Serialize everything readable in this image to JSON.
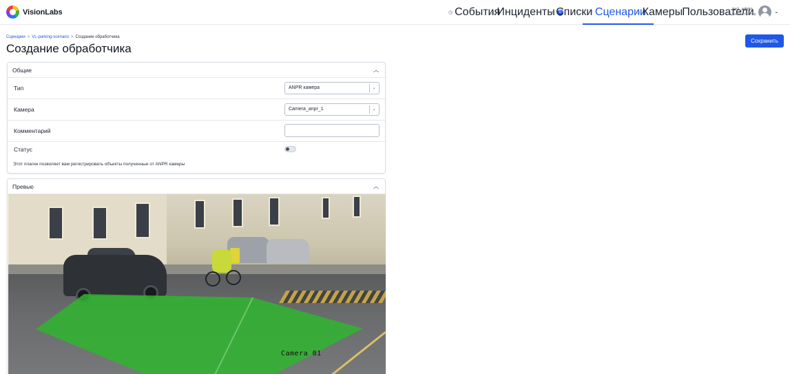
{
  "app": {
    "brand": "VisionLabs"
  },
  "nav": {
    "events": "События",
    "incidents": "Инциденты",
    "incidents_count": "0",
    "lists": "Списки",
    "scenarios": "Сценарии",
    "cameras": "Камеры",
    "users": "Пользователи"
  },
  "user": {
    "name": "test_admin",
    "role": "Администратор"
  },
  "breadcrumb": {
    "items": [
      "Сценарии",
      "VL-parking-scenario",
      "Создание обработчика"
    ],
    "separator": ">"
  },
  "page": {
    "title": "Создание обработчика"
  },
  "toolbar": {
    "save_label": "Сохранить"
  },
  "general": {
    "title": "Общие",
    "type_label": "Тип",
    "type_value": "ANPR камера",
    "camera_label": "Камера",
    "camera_value": "Camera_anpr_1",
    "comment_label": "Комментарий",
    "comment_value": "",
    "status_label": "Статус",
    "status_enabled": false,
    "note": "Этот плагин позволяет вам регистрировать объекты полученные от ANPR камеры"
  },
  "preview": {
    "title": "Превью",
    "camera_overlay": "Camera 01"
  },
  "colors": {
    "accent": "#1f57e8",
    "zone": "#2fb52f"
  }
}
